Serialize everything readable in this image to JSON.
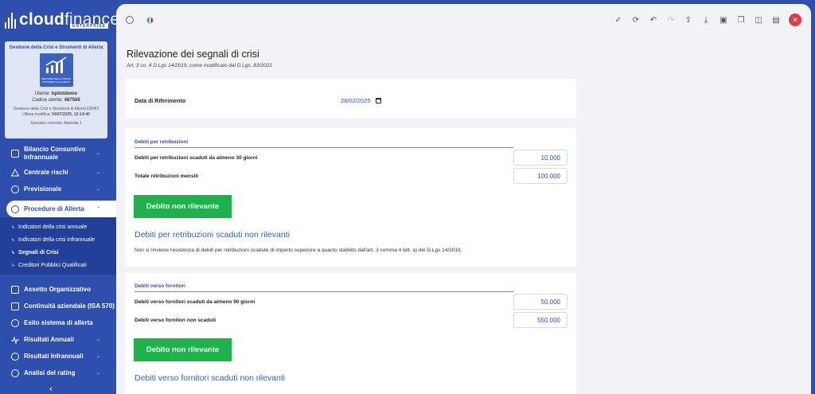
{
  "app": {
    "logo_bold": "cloud",
    "logo_light": "finance",
    "logo_sub": "ENTERPRISE"
  },
  "user_card": {
    "title": "Gestione della Crisi e Strumenti di Allerta",
    "image_caption": "GESTIONE DELLA CRISI E STRUMENTI DI ALLERTA",
    "user_label": "Utente:",
    "user_name": "bpilotdemo",
    "code_label": "Codice utente:",
    "code_value": "487566",
    "product": "Gestione della Crisi e Strumenti di Allerta DEMO",
    "last_mod_label": "Ultima modifica:",
    "last_mod_value": "04/07/2025, 12:14:40",
    "scenario": "Scenario corrente: Azienda 1"
  },
  "nav": {
    "items_top": [
      {
        "label": "Bilancio Consuntivo Infrannuale",
        "icon": "document-icon"
      },
      {
        "label": "Centrale rischi",
        "icon": "warning-icon"
      },
      {
        "label": "Previsionale",
        "icon": "watch-icon"
      }
    ],
    "active": {
      "label": "Procedure di Allerta",
      "icon": "alert-circle-icon"
    },
    "sub_items": [
      {
        "label": "Indicatori della crisi annuale"
      },
      {
        "label": "Indicatori della crisi infrannuale"
      },
      {
        "label": "Segnali di Crisi"
      },
      {
        "label": "Creditori Pubblici Qualificati"
      }
    ],
    "items_bottom": [
      {
        "label": "Assetto Organizzativo",
        "icon": "sliders-icon",
        "chev": false
      },
      {
        "label": "Continuità aziendale (ISA 570)",
        "icon": "database-icon",
        "chev": false
      },
      {
        "label": "Esito sistema di allerta",
        "icon": "check-circle-icon",
        "chev": false
      },
      {
        "label": "Risultati Annuali",
        "icon": "pulse-icon",
        "chev": true
      },
      {
        "label": "Risultati Infrannuali",
        "icon": "pie-icon",
        "chev": true
      },
      {
        "label": "Analisi del rating",
        "icon": "search-icon",
        "chev": true
      }
    ]
  },
  "toolbar": {
    "icons_right": [
      "check-icon",
      "refresh-icon",
      "undo-icon",
      "redo-icon",
      "upload-icon",
      "download-icon",
      "save-icon",
      "copy-icon",
      "columns-icon",
      "panel-icon",
      "close-icon"
    ]
  },
  "page": {
    "title": "Rilevazione dei segnali di crisi",
    "subtitle": "Art. 3 co. 4 D.Lgs 14/2019, come modificato dal D.Lgs. 83/2022"
  },
  "reference": {
    "label": "Data di Riferimento",
    "date": "28/02/2025"
  },
  "salaries": {
    "section_title": "Debiti per retribuzioni",
    "row1_label": "Debiti per retribuzioni scaduti da almeno 30 giorni",
    "row1_value": "10.000",
    "row2_label": "Totale retribuzioni mensili",
    "row2_value": "100.000",
    "button_label": "Debito non rilevante",
    "result_title": "Debiti per retribuzioni scaduti non rilevanti",
    "note": "Non si rinviene l'esistenza di debiti per retribuzioni scadute di importo superiore a quanto stabilito dall'art. 3 comma 4 lett. a) del D.Lgs 14/2019."
  },
  "suppliers": {
    "section_title": "Debiti verso fornitori",
    "row1_label": "Debiti verso fornitori scaduti da almeno 90 giorni",
    "row1_value": "50.000",
    "row2_label": "Debiti verso fornitori non scaduti",
    "row2_value": "550.000",
    "button_label": "Debito non rilevante",
    "result_title": "Debiti verso fornitori scaduti non rilevanti"
  }
}
